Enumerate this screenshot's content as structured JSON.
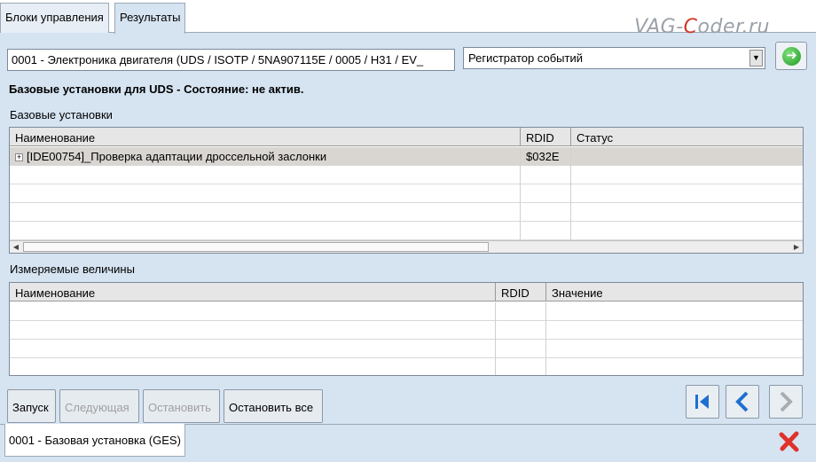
{
  "tabs": [
    {
      "label": "Блоки управления"
    },
    {
      "label": "Результаты"
    }
  ],
  "watermark": {
    "pre": "VAG-",
    "c": "C",
    "post": "oder.ru"
  },
  "controller": {
    "value": "0001 - Электроника двигателя  (UDS / ISOTP / 5NA907115E / 0005 / H31 / EV_"
  },
  "mode_select": {
    "value": "Регистратор событий"
  },
  "status_title": "Базовые установки для UDS - Состояние: не актив.",
  "basic_settings": {
    "label": "Базовые установки",
    "columns": [
      "Наименование",
      "RDID",
      "Статус"
    ],
    "rows": [
      {
        "name": "[IDE00754]_Проверка адаптации дроссельной заслонки",
        "rdid": "$032E",
        "status": ""
      }
    ]
  },
  "measured_values": {
    "label": "Измеряемые величины",
    "columns": [
      "Наименование",
      "RDID",
      "Значение"
    ]
  },
  "buttons": {
    "start": "Запуск",
    "next": "Следующая",
    "stop": "Остановить",
    "stop_all": "Остановить все"
  },
  "bottom_tab": {
    "label": "0001 - Базовая установка (GES)"
  },
  "colors": {
    "background": "#d6e4f2",
    "go_green": "#1e9a22",
    "nav_blue": "#1f6fd0",
    "close_red": "#e0322a"
  }
}
